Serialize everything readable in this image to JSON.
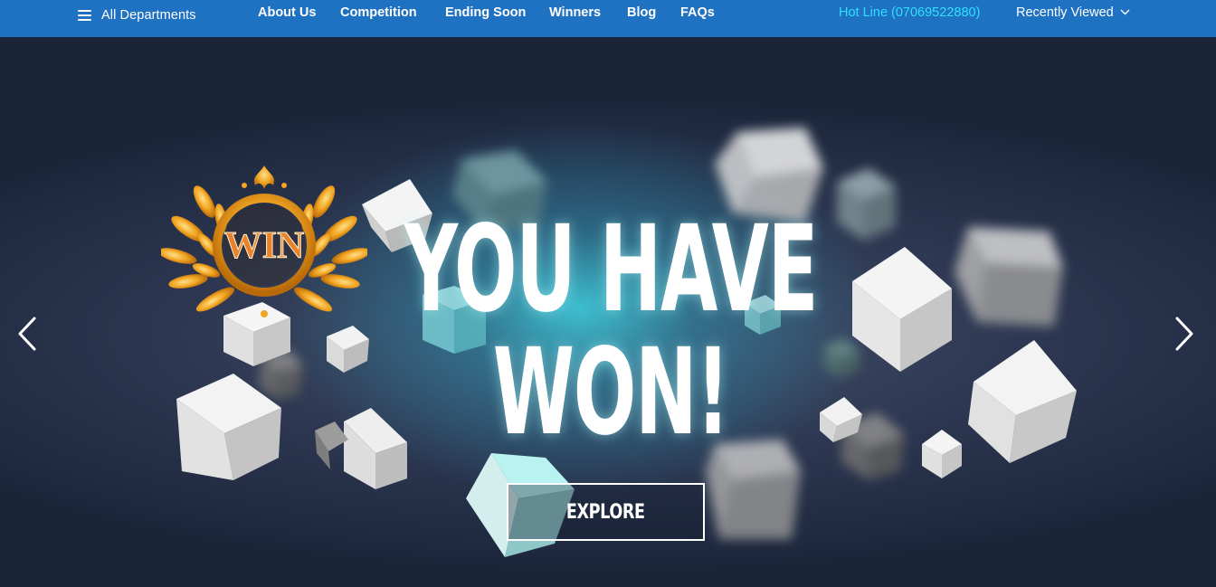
{
  "header": {
    "departments_label": "All Departments",
    "nav_items": [
      "About Us",
      "Competition",
      "Ending Soon",
      "Winners",
      "Blog",
      "FAQs"
    ],
    "hotline": "Hot Line (07069522880)",
    "recently_viewed": "Recently Viewed"
  },
  "hero": {
    "headline_line1": "YOU HAVE",
    "headline_line2": "WON!",
    "explore_label": "EXPLORE",
    "logo_text": "WIN"
  },
  "icons": {
    "menu": "hamburger-menu-icon",
    "dropdown": "chevron-down-icon",
    "prev": "chevron-left-icon",
    "next": "chevron-right-icon"
  },
  "colors": {
    "nav_bar": "#1f71c1",
    "hotline": "#2fe0ff",
    "hero_glow": "#3cd2e1",
    "logo_gold": "#f2a623"
  }
}
